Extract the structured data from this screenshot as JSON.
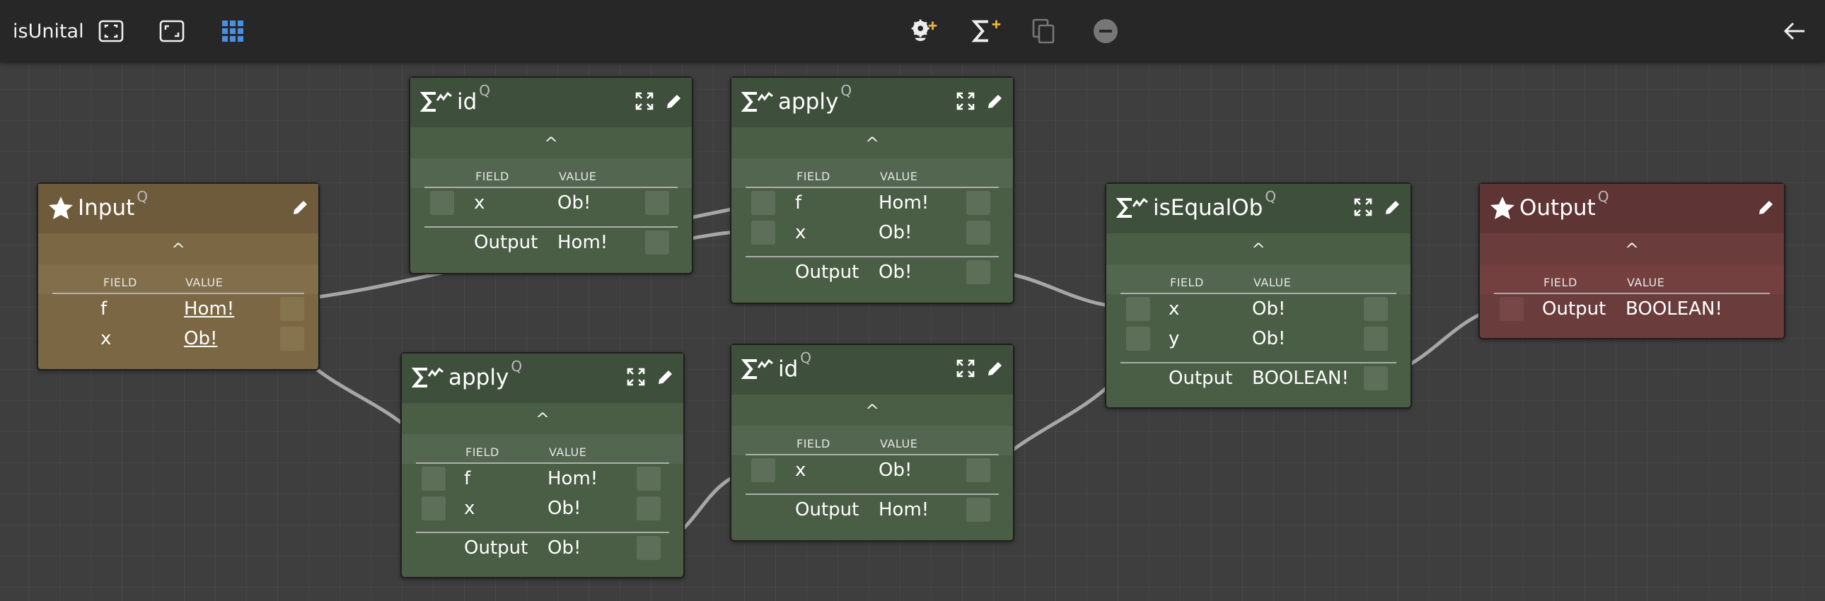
{
  "app": {
    "title": "isUnital"
  },
  "toolbar": {
    "left_icons": [
      "select-area-icon",
      "fit-view-icon",
      "grid-icon"
    ],
    "center_icons": [
      "add-node-icon",
      "add-function-icon",
      "copy-icon",
      "remove-icon"
    ],
    "right_icon": "back-arrow-icon",
    "accent_color": "#e8b23a",
    "grid_icon_color": "#4a90e2"
  },
  "common": {
    "field_header": "FIELD",
    "value_header": "VALUE",
    "collapse_caret": "^",
    "query_mark": "Q"
  },
  "nodes": {
    "input": {
      "title": "Input",
      "rows": [
        {
          "field": "f",
          "value": "Hom!"
        },
        {
          "field": "x",
          "value": "Ob!"
        }
      ]
    },
    "id_top": {
      "title": "id",
      "rows": [
        {
          "field": "x",
          "value": "Ob!"
        }
      ],
      "output": {
        "field": "Output",
        "value": "Hom!"
      }
    },
    "apply_top": {
      "title": "apply",
      "rows": [
        {
          "field": "f",
          "value": "Hom!"
        },
        {
          "field": "x",
          "value": "Ob!"
        }
      ],
      "output": {
        "field": "Output",
        "value": "Ob!"
      }
    },
    "apply_bottom": {
      "title": "apply",
      "rows": [
        {
          "field": "f",
          "value": "Hom!"
        },
        {
          "field": "x",
          "value": "Ob!"
        }
      ],
      "output": {
        "field": "Output",
        "value": "Ob!"
      }
    },
    "id_bottom": {
      "title": "id",
      "rows": [
        {
          "field": "x",
          "value": "Ob!"
        }
      ],
      "output": {
        "field": "Output",
        "value": "Hom!"
      }
    },
    "is_equal": {
      "title": "isEqualOb",
      "rows": [
        {
          "field": "x",
          "value": "Ob!"
        },
        {
          "field": "y",
          "value": "Ob!"
        }
      ],
      "output": {
        "field": "Output",
        "value": "BOOLEAN!"
      }
    },
    "output": {
      "title": "Output",
      "rows": [
        {
          "field": "Output",
          "value": "BOOLEAN!"
        }
      ]
    }
  }
}
